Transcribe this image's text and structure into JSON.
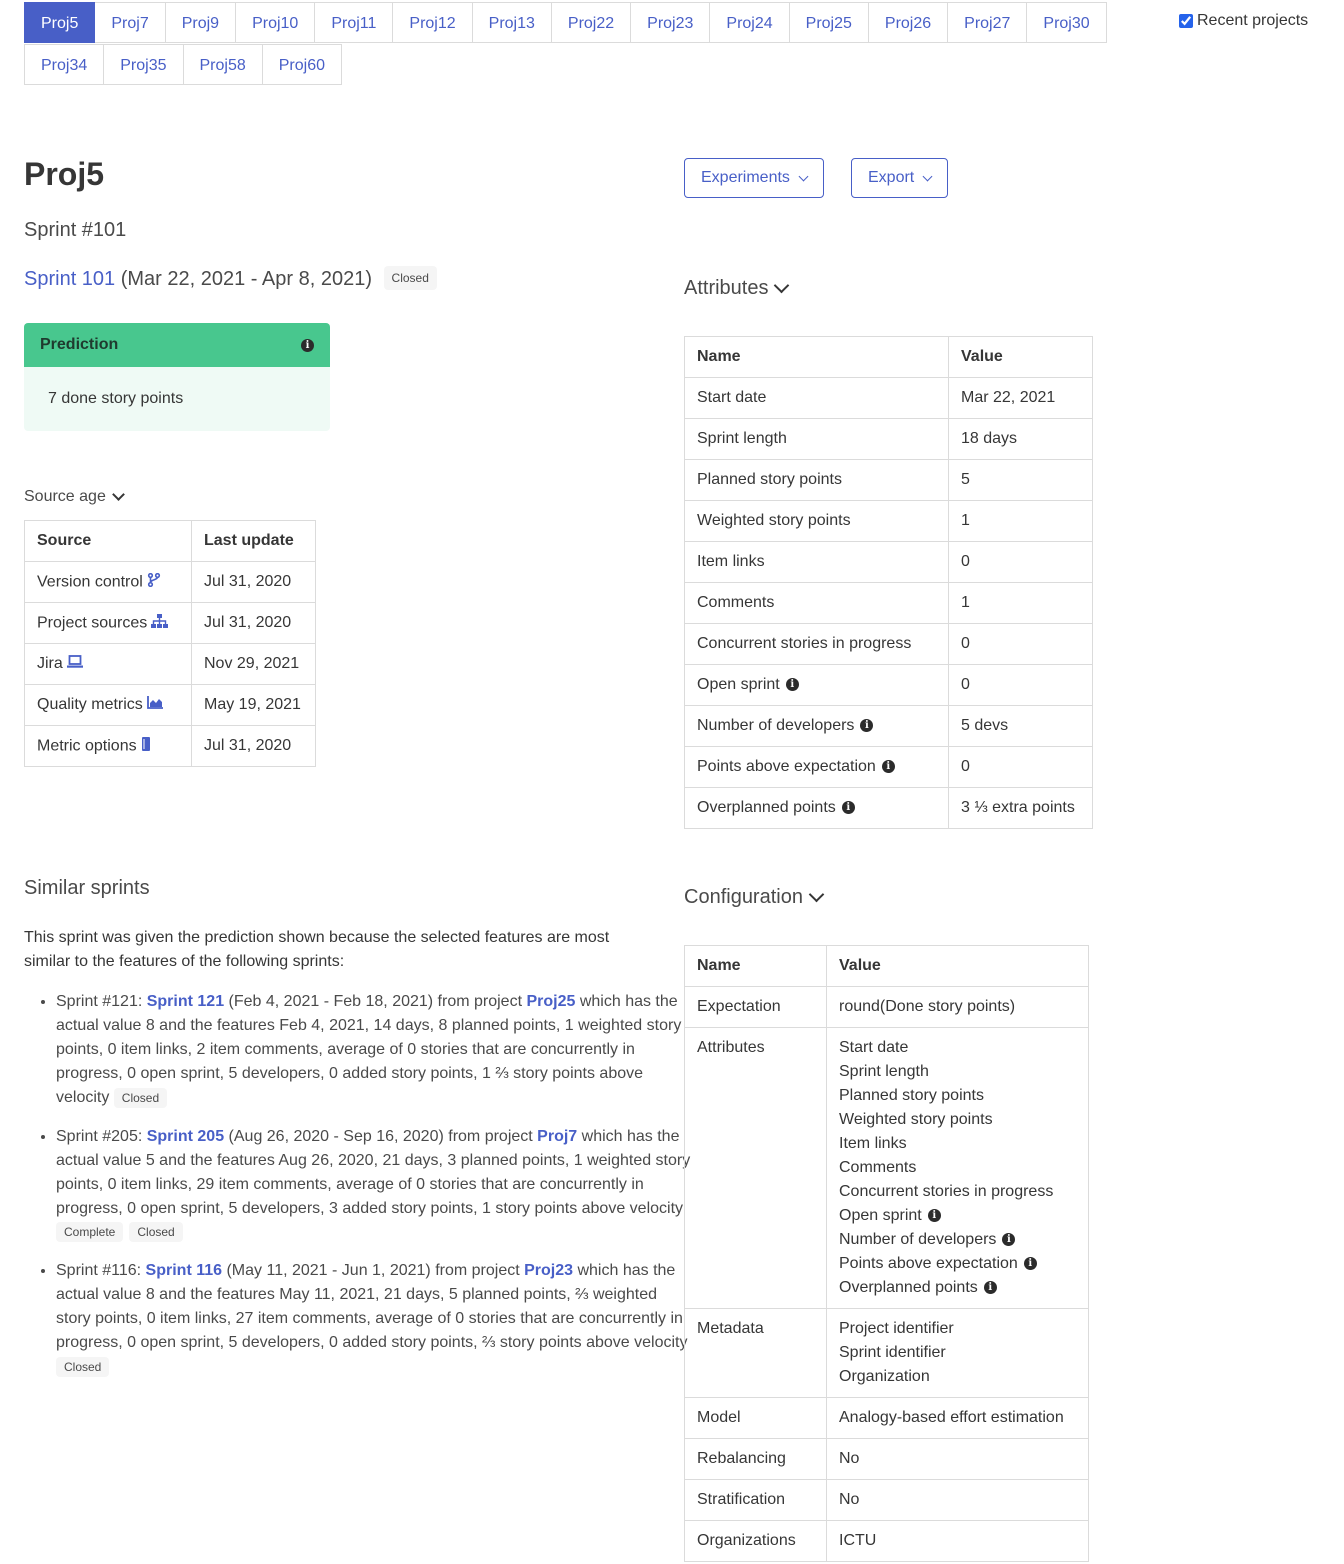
{
  "project_tabs": {
    "row1": [
      "Proj5",
      "Proj7",
      "Proj9",
      "Proj10",
      "Proj11",
      "Proj12",
      "Proj13",
      "Proj22",
      "Proj23",
      "Proj24",
      "Proj25",
      "Proj26",
      "Proj27",
      "Proj30"
    ],
    "row2": [
      "Proj34",
      "Proj35",
      "Proj58",
      "Proj60"
    ],
    "active": "Proj5"
  },
  "recent_projects": {
    "label": "Recent projects",
    "checked": true
  },
  "header": {
    "title": "Proj5",
    "sprint_subtitle": "Sprint #101",
    "sprint_link": "Sprint 101",
    "sprint_dates": "(Mar 22, 2021 - Apr 8, 2021)",
    "sprint_status": "Closed"
  },
  "buttons": {
    "experiments": "Experiments",
    "export": "Export"
  },
  "prediction": {
    "title": "Prediction",
    "value": "7 done story points"
  },
  "source_age": {
    "title": "Source age",
    "headers": [
      "Source",
      "Last update"
    ],
    "rows": [
      {
        "source": "Version control",
        "icon": "branch-icon",
        "date": "Jul 31, 2020"
      },
      {
        "source": "Project sources",
        "icon": "sitemap-icon",
        "date": "Jul 31, 2020"
      },
      {
        "source": "Jira",
        "icon": "laptop-icon",
        "date": "Nov 29, 2021"
      },
      {
        "source": "Quality metrics",
        "icon": "area-chart-icon",
        "date": "May 19, 2021"
      },
      {
        "source": "Metric options",
        "icon": "book-icon",
        "date": "Jul 31, 2020"
      }
    ]
  },
  "attributes": {
    "title": "Attributes",
    "headers": [
      "Name",
      "Value"
    ],
    "rows": [
      {
        "name": "Start date",
        "value": "Mar 22, 2021",
        "info": false
      },
      {
        "name": "Sprint length",
        "value": "18 days",
        "info": false
      },
      {
        "name": "Planned story points",
        "value": "5",
        "info": false
      },
      {
        "name": "Weighted story points",
        "value": "1",
        "info": false
      },
      {
        "name": "Item links",
        "value": "0",
        "info": false
      },
      {
        "name": "Comments",
        "value": "1",
        "info": false
      },
      {
        "name": "Concurrent stories in progress",
        "value": "0",
        "info": false
      },
      {
        "name": "Open sprint",
        "value": "0",
        "info": true
      },
      {
        "name": "Number of developers",
        "value": "5 devs",
        "info": true
      },
      {
        "name": "Points above expectation",
        "value": "0",
        "info": true
      },
      {
        "name": "Overplanned points",
        "value": "3 ⅓ extra points",
        "info": true
      }
    ]
  },
  "similar": {
    "title": "Similar sprints",
    "intro": "This sprint was given the prediction shown because the selected features are most similar to the features of the following sprints:",
    "items": [
      {
        "prefix": "Sprint #121: ",
        "sprint_link": "Sprint 121",
        "dates": " (Feb 4, 2021 - Feb 18, 2021) from project ",
        "project": "Proj25",
        "text": " which has the actual value 8 and the features Feb 4, 2021, 14 days, 8 planned points, 1 weighted story points, 0 item links, 2 item comments, average of 0 stories that are concurrently in progress, 0 open sprint, 5 developers, 0 added story points, 1 ⅔ story points above velocity ",
        "tags": [
          "Closed"
        ]
      },
      {
        "prefix": "Sprint #205: ",
        "sprint_link": "Sprint 205",
        "dates": " (Aug 26, 2020 - Sep 16, 2020) from project ",
        "project": "Proj7",
        "text": " which has the actual value 5 and the features Aug 26, 2020, 21 days, 3 planned points, 1 weighted story points, 0 item links, 29 item comments, average of 0 stories that are concurrently in progress, 0 open sprint, 5 developers, 3 added story points, 1 story points above velocity ",
        "tags": [
          "Complete",
          "Closed"
        ]
      },
      {
        "prefix": "Sprint #116: ",
        "sprint_link": "Sprint 116",
        "dates": " (May 11, 2021 - Jun 1, 2021) from project ",
        "project": "Proj23",
        "text": " which has the actual value 8 and the features May 11, 2021, 21 days, 5 planned points, ⅔ weighted story points, 0 item links, 27 item comments, average of 0 stories that are concurrently in progress, 0 open sprint, 5 developers, 0 added story points, ⅔ story points above velocity ",
        "tags": [
          "Closed"
        ]
      }
    ]
  },
  "configuration": {
    "title": "Configuration",
    "headers": [
      "Name",
      "Value"
    ],
    "expectation": {
      "name": "Expectation",
      "value": "round(Done story points)"
    },
    "attributes": {
      "name": "Attributes",
      "values": [
        {
          "v": "Start date",
          "info": false
        },
        {
          "v": "Sprint length",
          "info": false
        },
        {
          "v": "Planned story points",
          "info": false
        },
        {
          "v": "Weighted story points",
          "info": false
        },
        {
          "v": "Item links",
          "info": false
        },
        {
          "v": "Comments",
          "info": false
        },
        {
          "v": "Concurrent stories in progress",
          "info": false
        },
        {
          "v": "Open sprint",
          "info": true
        },
        {
          "v": "Number of developers",
          "info": true
        },
        {
          "v": "Points above expectation",
          "info": true
        },
        {
          "v": "Overplanned points",
          "info": true
        }
      ]
    },
    "metadata": {
      "name": "Metadata",
      "values": [
        "Project identifier",
        "Sprint identifier",
        "Organization"
      ]
    },
    "rows": [
      {
        "name": "Model",
        "value": "Analogy-based effort estimation"
      },
      {
        "name": "Rebalancing",
        "value": "No"
      },
      {
        "name": "Stratification",
        "value": "No"
      },
      {
        "name": "Organizations",
        "value": "ICTU"
      }
    ]
  }
}
